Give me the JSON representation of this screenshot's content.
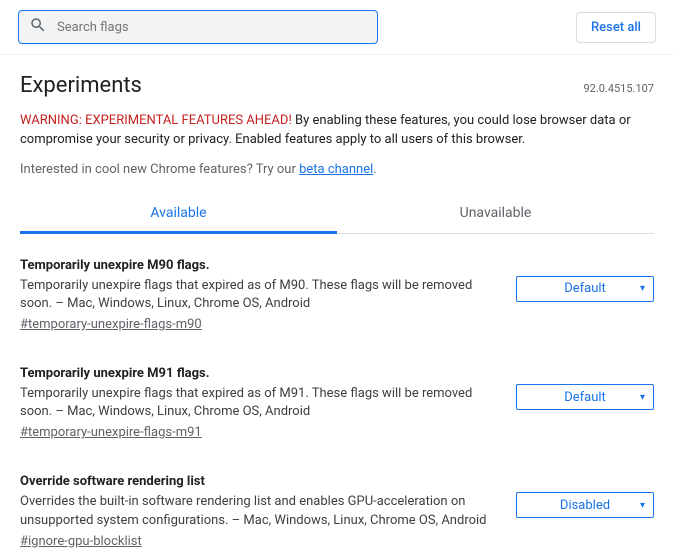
{
  "search": {
    "placeholder": "Search flags"
  },
  "reset_label": "Reset all",
  "header": {
    "title": "Experiments",
    "version": "92.0.4515.107"
  },
  "warning": {
    "label": "WARNING: EXPERIMENTAL FEATURES AHEAD! ",
    "text": "By enabling these features, you could lose browser data or compromise your security or privacy. Enabled features apply to all users of this browser."
  },
  "interest": {
    "prefix": "Interested in cool new Chrome features? Try our ",
    "link": "beta channel",
    "suffix": "."
  },
  "tabs": {
    "available": "Available",
    "unavailable": "Unavailable"
  },
  "flags": [
    {
      "title": "Temporarily unexpire M90 flags.",
      "desc": "Temporarily unexpire flags that expired as of M90. These flags will be removed soon. – Mac, Windows, Linux, Chrome OS, Android",
      "anchor": "#temporary-unexpire-flags-m90",
      "value": "Default"
    },
    {
      "title": "Temporarily unexpire M91 flags.",
      "desc": "Temporarily unexpire flags that expired as of M91. These flags will be removed soon. – Mac, Windows, Linux, Chrome OS, Android",
      "anchor": "#temporary-unexpire-flags-m91",
      "value": "Default"
    },
    {
      "title": "Override software rendering list",
      "desc": "Overrides the built-in software rendering list and enables GPU-acceleration on unsupported system configurations. – Mac, Windows, Linux, Chrome OS, Android",
      "anchor": "#ignore-gpu-blocklist",
      "value": "Disabled"
    }
  ]
}
